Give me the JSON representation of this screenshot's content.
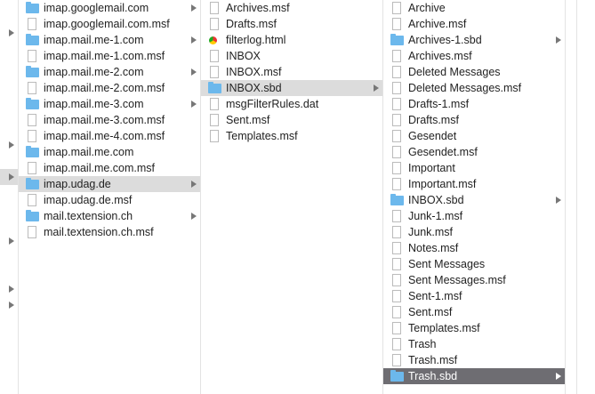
{
  "col0": {
    "arrow_rows": [
      37,
      163,
      199,
      271,
      325,
      343
    ]
  },
  "col1": {
    "items": [
      {
        "name": "imap.googlemail.com",
        "type": "folder",
        "arrow": true
      },
      {
        "name": "imap.googlemail.com.msf",
        "type": "file"
      },
      {
        "name": "imap.mail.me-1.com",
        "type": "folder",
        "arrow": true
      },
      {
        "name": "imap.mail.me-1.com.msf",
        "type": "file"
      },
      {
        "name": "imap.mail.me-2.com",
        "type": "folder",
        "arrow": true
      },
      {
        "name": "imap.mail.me-2.com.msf",
        "type": "file"
      },
      {
        "name": "imap.mail.me-3.com",
        "type": "folder",
        "arrow": true
      },
      {
        "name": "imap.mail.me-3.com.msf",
        "type": "file"
      },
      {
        "name": "imap.mail.me-4.com.msf",
        "type": "file"
      },
      {
        "name": "imap.mail.me.com",
        "type": "folder"
      },
      {
        "name": "imap.mail.me.com.msf",
        "type": "file"
      },
      {
        "name": "imap.udag.de",
        "type": "folder",
        "arrow": true,
        "state": "sel"
      },
      {
        "name": "imap.udag.de.msf",
        "type": "file"
      },
      {
        "name": "mail.textension.ch",
        "type": "folder",
        "arrow": true
      },
      {
        "name": "mail.textension.ch.msf",
        "type": "file"
      }
    ]
  },
  "col2": {
    "items": [
      {
        "name": "Archives.msf",
        "type": "file"
      },
      {
        "name": "Drafts.msf",
        "type": "file"
      },
      {
        "name": "filterlog.html",
        "type": "html"
      },
      {
        "name": "INBOX",
        "type": "file"
      },
      {
        "name": "INBOX.msf",
        "type": "file"
      },
      {
        "name": "INBOX.sbd",
        "type": "folder",
        "arrow": true,
        "state": "sel"
      },
      {
        "name": "msgFilterRules.dat",
        "type": "file"
      },
      {
        "name": "Sent.msf",
        "type": "file"
      },
      {
        "name": "Templates.msf",
        "type": "file"
      }
    ]
  },
  "col3": {
    "items": [
      {
        "name": "Archive",
        "type": "file"
      },
      {
        "name": "Archive.msf",
        "type": "file"
      },
      {
        "name": "Archives-1.sbd",
        "type": "folder",
        "arrow": true
      },
      {
        "name": "Archives.msf",
        "type": "file"
      },
      {
        "name": "Deleted Messages",
        "type": "file"
      },
      {
        "name": "Deleted Messages.msf",
        "type": "file"
      },
      {
        "name": "Drafts-1.msf",
        "type": "file"
      },
      {
        "name": "Drafts.msf",
        "type": "file"
      },
      {
        "name": "Gesendet",
        "type": "file"
      },
      {
        "name": "Gesendet.msf",
        "type": "file"
      },
      {
        "name": "Important",
        "type": "file"
      },
      {
        "name": "Important.msf",
        "type": "file"
      },
      {
        "name": "INBOX.sbd",
        "type": "folder",
        "arrow": true
      },
      {
        "name": "Junk-1.msf",
        "type": "file"
      },
      {
        "name": "Junk.msf",
        "type": "file"
      },
      {
        "name": "Notes.msf",
        "type": "file"
      },
      {
        "name": "Sent Messages",
        "type": "file"
      },
      {
        "name": "Sent Messages.msf",
        "type": "file"
      },
      {
        "name": "Sent-1.msf",
        "type": "file"
      },
      {
        "name": "Sent.msf",
        "type": "file"
      },
      {
        "name": "Templates.msf",
        "type": "file"
      },
      {
        "name": "Trash",
        "type": "file"
      },
      {
        "name": "Trash.msf",
        "type": "file"
      },
      {
        "name": "Trash.sbd",
        "type": "folder",
        "arrow": true,
        "state": "act"
      }
    ]
  }
}
